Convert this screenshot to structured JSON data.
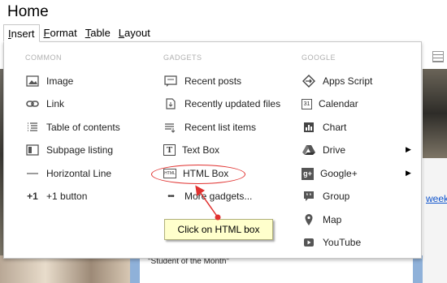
{
  "page": {
    "title": "Home"
  },
  "menubar": [
    {
      "label": "Insert",
      "underline": "I",
      "rest": "nsert"
    },
    {
      "label": "Format",
      "underline": "F",
      "rest": "ormat"
    },
    {
      "label": "Table",
      "underline": "T",
      "rest": "able"
    },
    {
      "label": "Layout",
      "underline": "L",
      "rest": "ayout"
    }
  ],
  "dropdown": {
    "common": {
      "heading": "COMMON",
      "items": [
        {
          "label": "Image",
          "icon": "image-icon"
        },
        {
          "label": "Link",
          "icon": "link-icon"
        },
        {
          "label": "Table of contents",
          "icon": "table-of-contents-icon"
        },
        {
          "label": "Subpage listing",
          "icon": "subpage-listing-icon"
        },
        {
          "label": "Horizontal Line",
          "icon": "horizontal-line-icon"
        },
        {
          "label": "+1 button",
          "icon": "plus-one-icon",
          "glyph": "+1"
        }
      ]
    },
    "gadgets": {
      "heading": "GADGETS",
      "items": [
        {
          "label": "Recent posts",
          "icon": "recent-posts-icon"
        },
        {
          "label": "Recently updated files",
          "icon": "recent-files-icon"
        },
        {
          "label": "Recent list items",
          "icon": "recent-list-icon"
        },
        {
          "label": "Text Box",
          "icon": "text-box-icon",
          "glyph": "T"
        },
        {
          "label": "HTML Box",
          "icon": "html-box-icon",
          "glyph": "HTML"
        },
        {
          "label": "More gadgets...",
          "icon": "more-gadgets-icon",
          "glyph": "•••"
        }
      ]
    },
    "google": {
      "heading": "GOOGLE",
      "items": [
        {
          "label": "Apps Script",
          "icon": "apps-script-icon"
        },
        {
          "label": "Calendar",
          "icon": "calendar-icon",
          "glyph": "31"
        },
        {
          "label": "Chart",
          "icon": "chart-icon"
        },
        {
          "label": "Drive",
          "icon": "drive-icon",
          "submenu": true
        },
        {
          "label": "Google+",
          "icon": "google-plus-icon",
          "glyph": "g+",
          "submenu": true
        },
        {
          "label": "Group",
          "icon": "group-icon"
        },
        {
          "label": "Map",
          "icon": "map-icon"
        },
        {
          "label": "YouTube",
          "icon": "youtube-icon"
        }
      ]
    }
  },
  "callout": {
    "text": "Click on HTML box"
  },
  "background": {
    "inner_text": "\"Student of the Month\"",
    "right_link": "week, c"
  },
  "colors": {
    "annotation_red": "#e0312f",
    "callout_bg": "#ffffcc"
  }
}
